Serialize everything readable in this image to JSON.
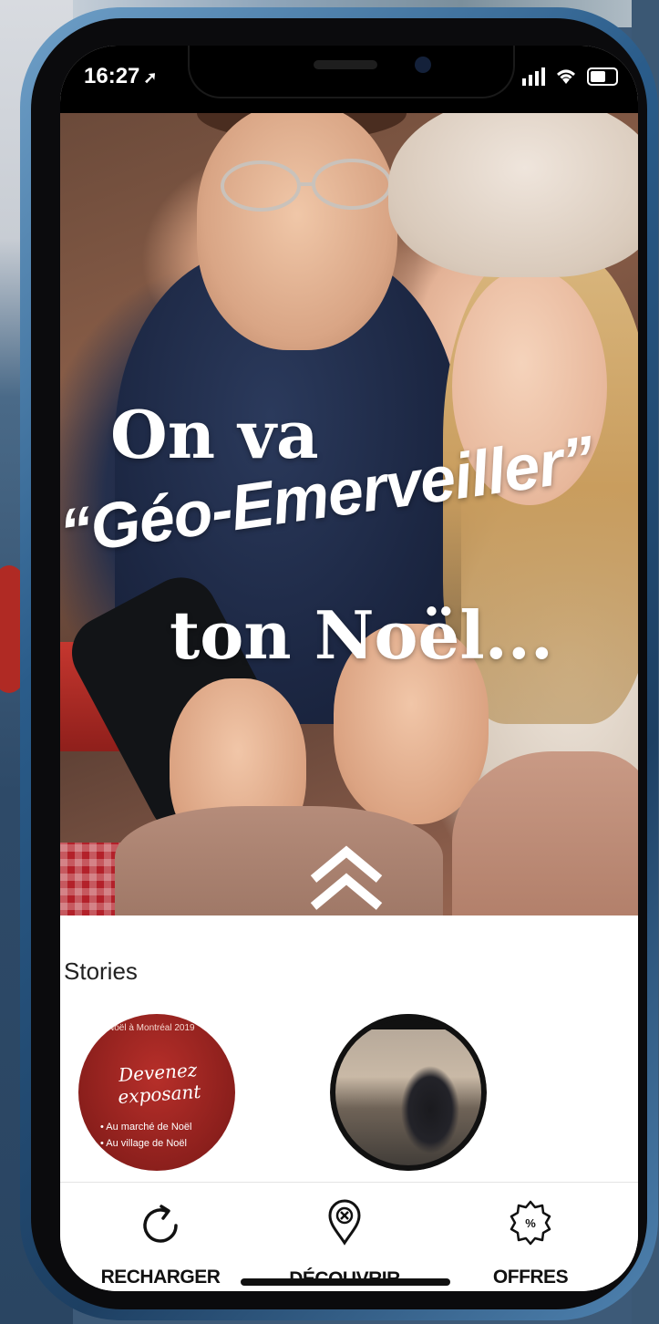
{
  "status_bar": {
    "time": "16:27",
    "location_icon": "location-arrow-icon",
    "signal_icon": "cellular-signal-icon",
    "wifi_icon": "wifi-icon",
    "battery_icon": "battery-icon"
  },
  "hero": {
    "line1": "On va",
    "line2": "“Géo-Emerveiller”",
    "line3": "ton Noël...",
    "scroll_icon": "double-chevron-up-icon"
  },
  "stories": {
    "title": "Stories",
    "items": [
      {
        "top_text": "Noël à Montréal 2019",
        "headline": "Devenez exposant",
        "line_a": "• Au marché de Noël",
        "line_b": "• Au village de Noël"
      },
      {
        "image": "workshop-photo"
      }
    ]
  },
  "bottom_nav": {
    "items": [
      {
        "label": "RECHARGER",
        "icon": "refresh-icon"
      },
      {
        "label": "DÉCOUVRIR",
        "icon": "map-pin-icon"
      },
      {
        "label": "OFFRES",
        "icon": "discount-badge-icon"
      }
    ]
  },
  "colors": {
    "frame": "#2a5c8a",
    "text_dark": "#111111",
    "story_red": "#8b1f1c"
  }
}
